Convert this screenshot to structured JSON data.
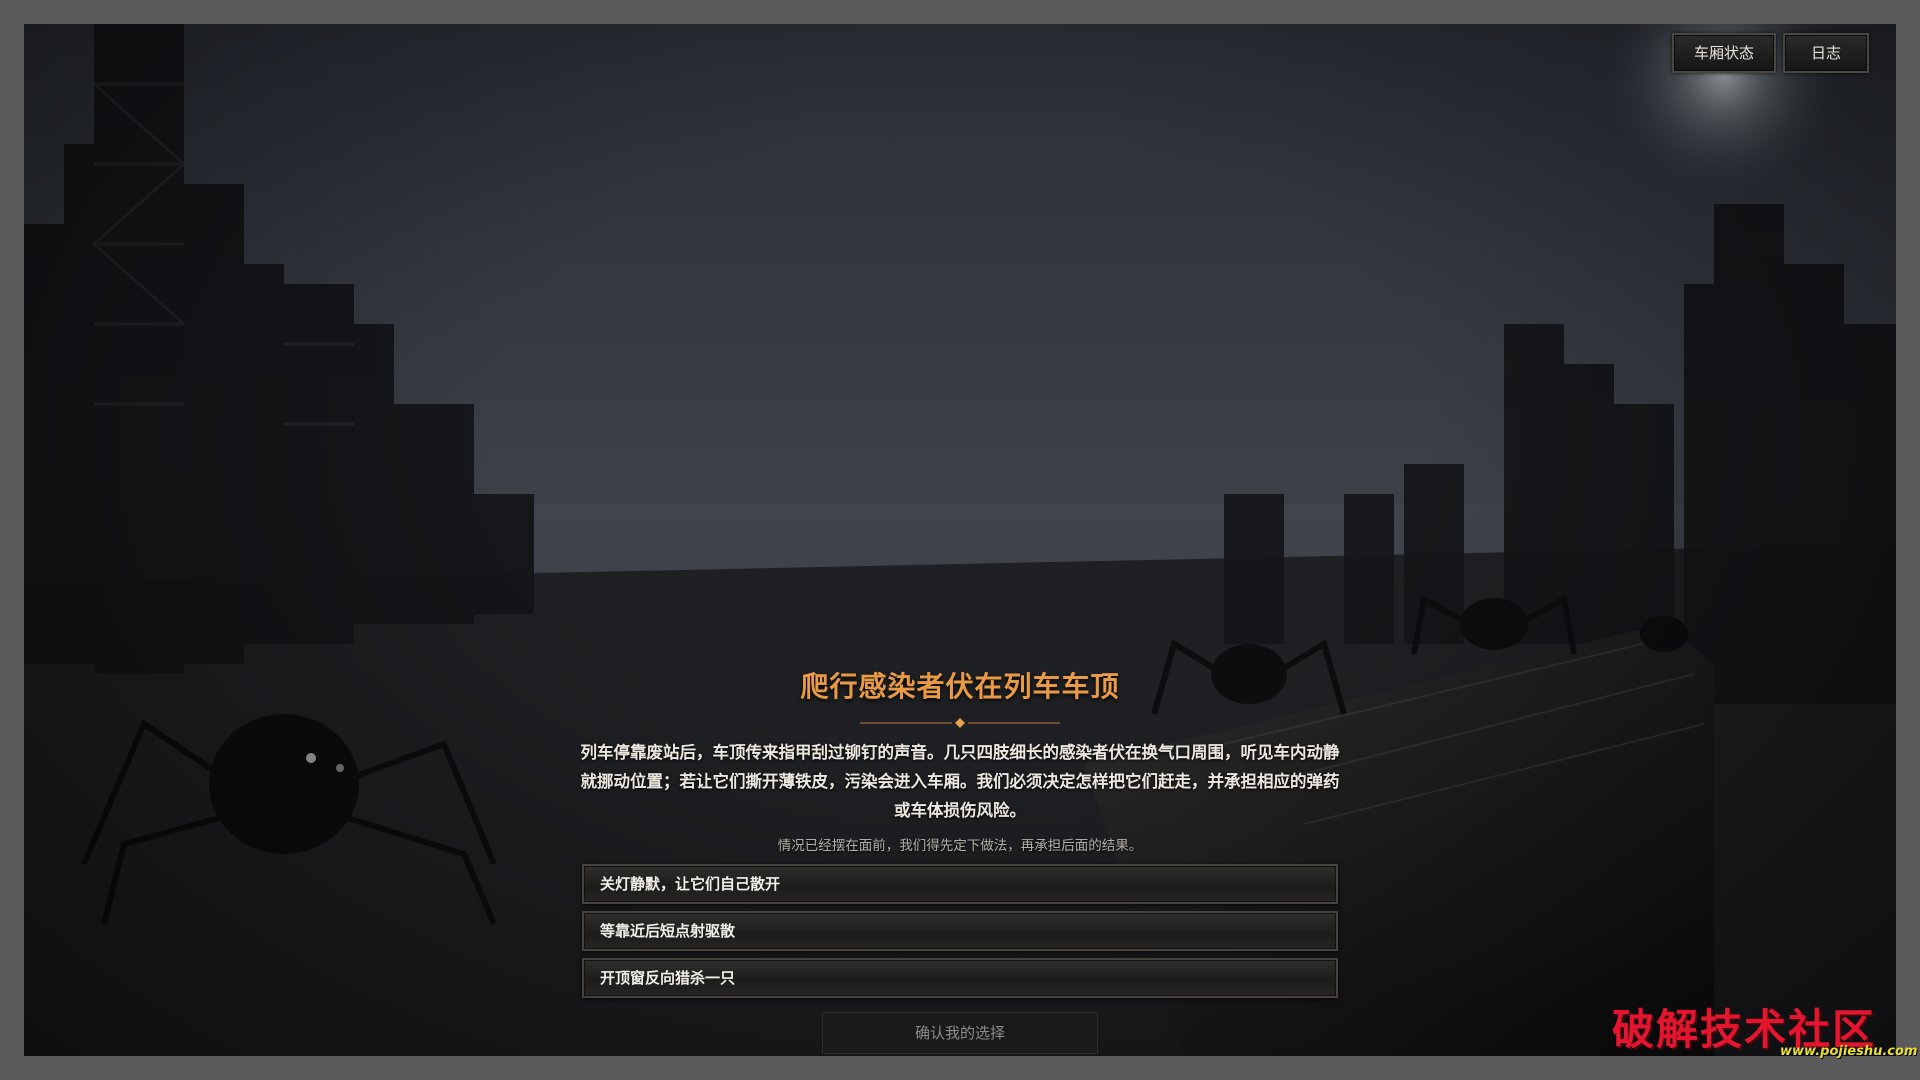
{
  "header": {
    "carriage_status_label": "车厢状态",
    "log_label": "日志"
  },
  "event": {
    "title": "爬行感染者伏在列车车顶",
    "description": "列车停靠废站后，车顶传来指甲刮过铆钉的声音。几只四肢细长的感染者伏在换气口周围，听见车内动静就挪动位置；若让它们撕开薄铁皮，污染会进入车厢。我们必须决定怎样把它们赶走，并承担相应的弹药或车体损伤风险。",
    "hint": "情况已经摆在面前，我们得先定下做法，再承担后面的结果。",
    "choices": [
      {
        "label": "关灯静默，让它们自己散开"
      },
      {
        "label": "等靠近后短点射驱散"
      },
      {
        "label": "开顶窗反向猎杀一只"
      }
    ],
    "confirm_label": "确认我的选择"
  },
  "watermark": {
    "text": "破解技术社区",
    "url": "www.pojieshu.com"
  },
  "colors": {
    "title_accent": "#e89a45",
    "watermark_red": "#e3152f",
    "watermark_yellow": "#e8e030"
  }
}
